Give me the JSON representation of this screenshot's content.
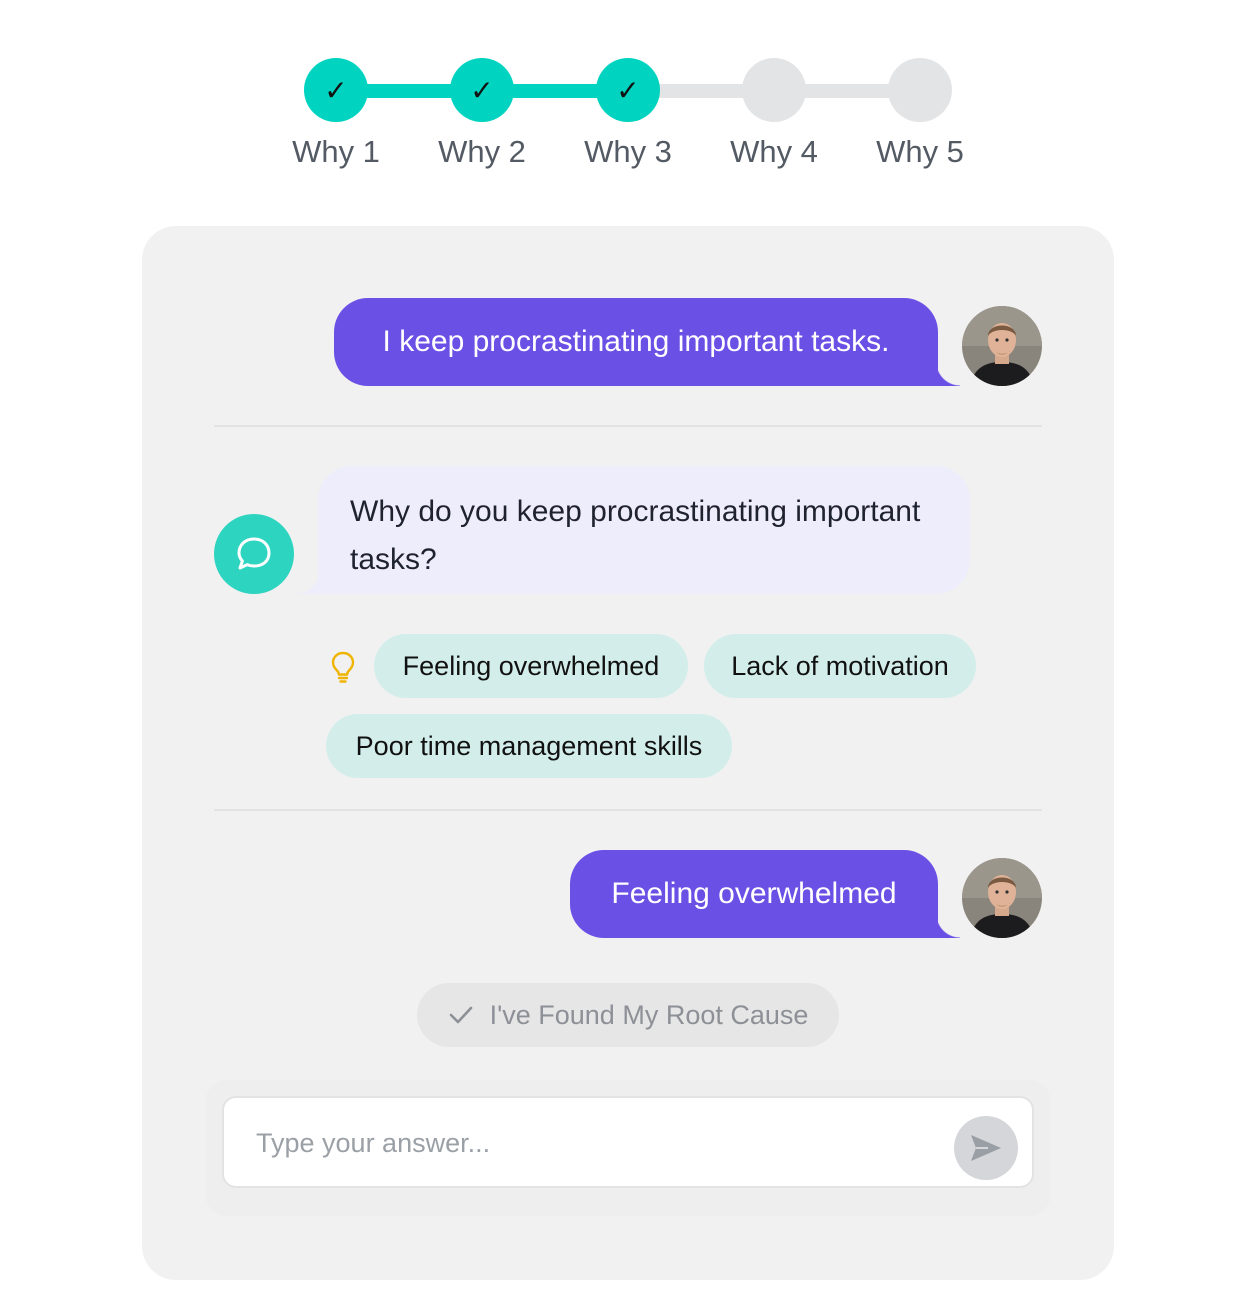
{
  "stepper": {
    "steps": [
      {
        "label": "Why 1",
        "status": "done",
        "mark": "✓"
      },
      {
        "label": "Why 2",
        "status": "done",
        "mark": "✓"
      },
      {
        "label": "Why 3",
        "status": "done",
        "mark": "✓"
      },
      {
        "label": "Why 4",
        "status": "todo",
        "mark": ""
      },
      {
        "label": "Why 5",
        "status": "todo",
        "mark": ""
      }
    ],
    "completed_count": 3
  },
  "chat": {
    "user_message_1": "I keep procrastinating important tasks.",
    "bot_question": "Why do you keep procrastinating important tasks?",
    "suggestions_icon": "lightbulb-icon",
    "suggestions": [
      "Feeling overwhelmed",
      "Lack of motivation",
      "Poor time management skills"
    ],
    "user_message_2": "Feeling overwhelmed",
    "root_cause_label": "I've Found My Root Cause"
  },
  "composer": {
    "placeholder": "Type your answer...",
    "send_icon": "send-icon"
  },
  "colors": {
    "accent_teal": "#00d4c0",
    "user_bubble": "#6b50e6",
    "bot_bubble": "#eeedfb",
    "chip_bg": "#d3eeea",
    "bulb": "#f0b400"
  }
}
